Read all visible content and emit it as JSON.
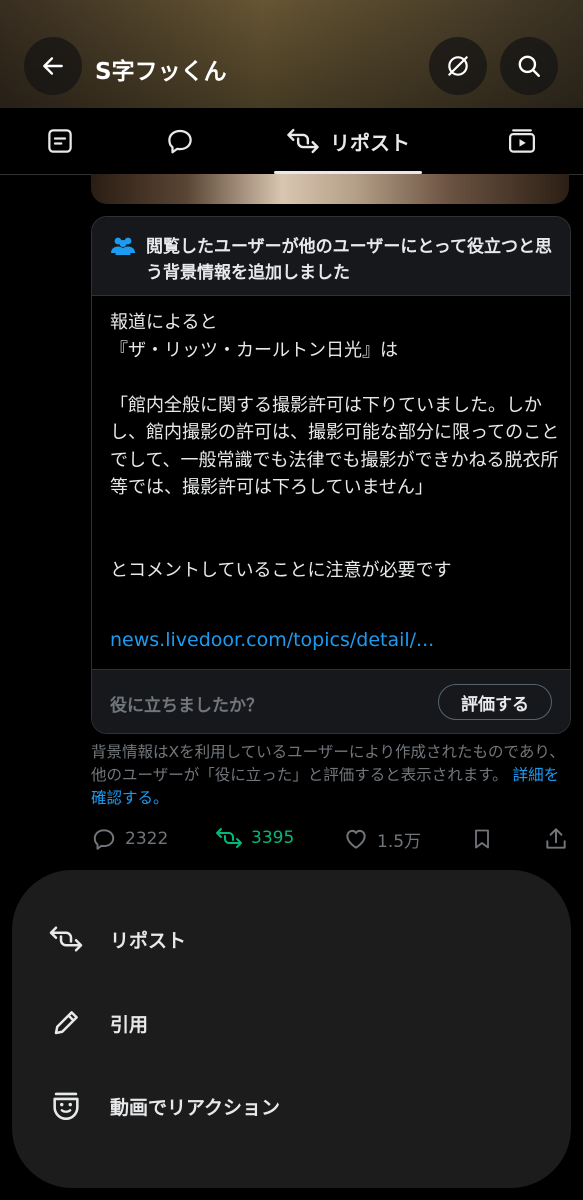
{
  "header": {
    "title": "S字フッくん",
    "icons": [
      "back-arrow-icon",
      "grok-icon",
      "search-icon"
    ]
  },
  "tabs": [
    {
      "icon": "article-icon",
      "label": ""
    },
    {
      "icon": "reply-icon",
      "label": ""
    },
    {
      "icon": "repost-icon",
      "label": "リポスト",
      "active": true
    },
    {
      "icon": "video-icon",
      "label": ""
    }
  ],
  "note": {
    "heading": "閲覧したユーザーが他のユーザーにとって役立つと思う背景情報を追加しました",
    "body": "報道によると\n『ザ・リッツ・カールトン日光』は\n\n「館内全般に関する撮影許可は下りていました。しかし、館内撮影の許可は、撮影可能な部分に限ってのことでして、一般常識でも法律でも撮影ができかねる脱衣所等では、撮影許可は下ろしていません」\n\n\nとコメントしていることに注意が必要です",
    "link": "news.livedoor.com/topics/detail/...",
    "helpful_question": "役に立ちましたか？",
    "rate_button": "評価する"
  },
  "disclaimer": {
    "text": "背景情報はXを利用しているユーザーにより作成されたものであり、他のユーザーが「役に立った」と評価すると表示されます。",
    "link": "詳細を確認する。"
  },
  "actions": {
    "replies": "2322",
    "reposts": "3395",
    "likes": "1.5万",
    "colors": {
      "repost": "#00ba7c",
      "muted": "#71767b",
      "link": "#1d9bf0"
    }
  },
  "sheet": {
    "items": [
      {
        "icon": "repost-icon",
        "label": "リポスト"
      },
      {
        "icon": "pencil-icon",
        "label": "引用"
      },
      {
        "icon": "video-reaction-icon",
        "label": "動画でリアクション"
      }
    ]
  }
}
